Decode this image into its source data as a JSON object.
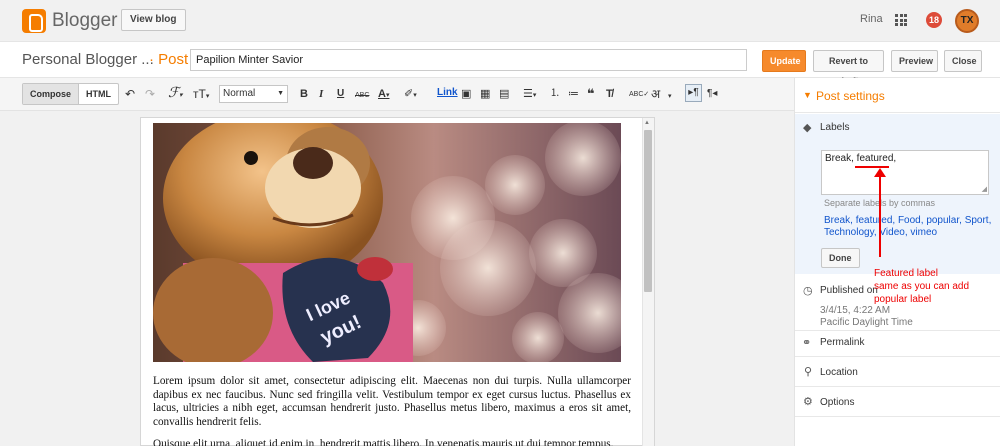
{
  "topbar": {
    "brand": "Blogger",
    "view_blog": "View blog",
    "user_name": "Rina",
    "notification_count": "18",
    "avatar_text": "TX"
  },
  "title_row": {
    "blog_name": "Personal Blogger ...",
    "post_label": "· Post",
    "post_title": "Papilion Minter Savior",
    "buttons": {
      "update": "Update",
      "revert": "Revert to draft",
      "preview": "Preview",
      "close": "Close"
    }
  },
  "toolbar": {
    "compose": "Compose",
    "html": "HTML",
    "format": "Normal",
    "link": "Link",
    "hindi": "अ"
  },
  "editor": {
    "paragraph1": "Lorem ipsum dolor sit amet, consectetur adipiscing elit. Maecenas non dui turpis. Nulla ullamcorper dapibus ex nec faucibus. Nunc sed fringilla velit. Vestibulum tempor ex eget cursus luctus. Phasellus ex lacus, ultricies a nibh eget, accumsan hendrerit justo. Phasellus metus libero, maximus a eros sit amet, convallis hendrerit felis.",
    "paragraph2": "Quisque elit urna, aliquet id enim in, hendrerit mattis libero. In venenatis mauris ut dui tempor tempus."
  },
  "sidebar": {
    "post_settings": "Post settings",
    "labels": {
      "title": "Labels",
      "value": "Break, featured,",
      "help": "Separate labels by commas",
      "suggestions": [
        "Break",
        "featured",
        "Food",
        "popular",
        "Sport",
        "Technology",
        "Video",
        "vimeo"
      ],
      "done": "Done"
    },
    "published": {
      "title": "Published on",
      "date": "3/4/15, 4:22 AM",
      "timezone": "Pacific Daylight Time"
    },
    "permalink": "Permalink",
    "location": "Location",
    "options": "Options"
  },
  "annotation": {
    "line1": "Featured label",
    "line2": "same as you can add",
    "line3": "popular label",
    "color": "#ee0000"
  },
  "colors": {
    "accent": "#f57d00",
    "link": "#1155cc",
    "labels_panel_bg": "#eef4fc"
  }
}
